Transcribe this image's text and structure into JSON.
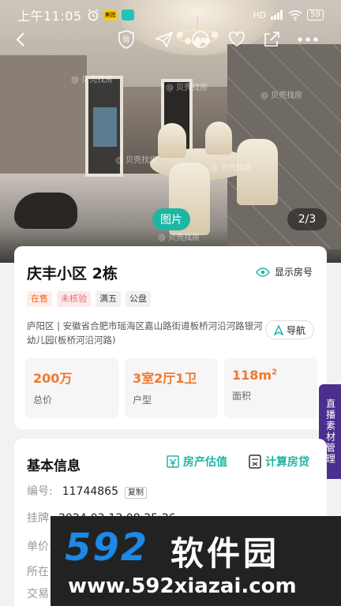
{
  "status_bar": {
    "time": "上午11:05",
    "app_badge_1": "美团",
    "app_badge_2": "",
    "signal": "HD",
    "battery": "59"
  },
  "photo": {
    "watermark": "@ 贝壳找房",
    "label": "图片",
    "counter": "2/3"
  },
  "listing": {
    "title": "庆丰小区  2栋",
    "show_number_label": "显示房号",
    "tags": [
      "在售",
      "未核验",
      "满五",
      "公盘"
    ],
    "address": "庐阳区 | 安徽省合肥市瑶海区嘉山路街道板桥河沿河路银河幼儿园(板桥河沿河路)",
    "navigate_label": "导航",
    "stats": [
      {
        "value": "200万",
        "label": "总价"
      },
      {
        "value": "3室2厅1卫",
        "label": "户型"
      },
      {
        "value": "118m",
        "unit_sup": "2",
        "label": "面积"
      }
    ]
  },
  "side_tab": "直播素材管理",
  "basic_info": {
    "title": "基本信息",
    "estimate_label": "房产估值",
    "mortgage_label": "计算房贷",
    "rows": [
      {
        "label": "编号:",
        "value": "11744865",
        "copy_label": "复制"
      },
      {
        "label": "挂牌",
        "value": "2024-03-12 08:25:26"
      },
      {
        "label": "单价",
        "value": ""
      },
      {
        "label": "所在",
        "value": ""
      },
      {
        "label": "交易",
        "value": ""
      }
    ]
  },
  "promo": {
    "brand": "592",
    "brand_text": "软件园",
    "url": "www.592xiazai.com"
  },
  "colors": {
    "accent": "#1fb5a3",
    "price": "#f2772c",
    "side_tab": "#4a2f8f"
  }
}
